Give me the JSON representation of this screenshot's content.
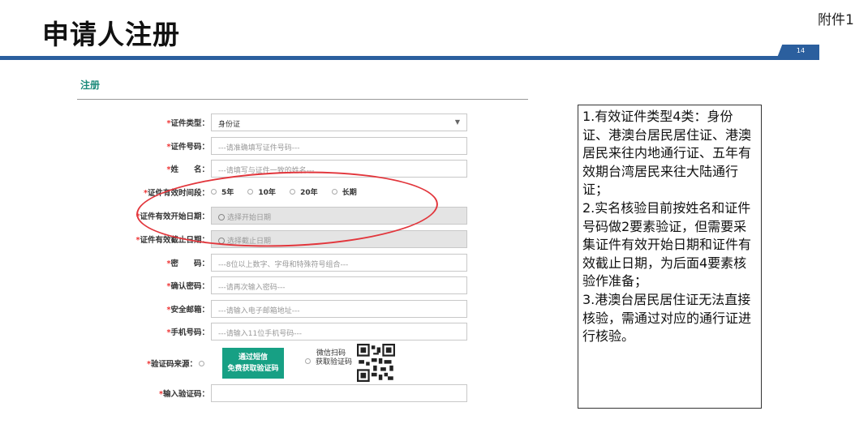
{
  "slide": {
    "title": "申请人注册",
    "appendix": "附件1",
    "page_number": "14"
  },
  "form": {
    "heading": "注册",
    "fields": {
      "id_type": {
        "label": "证件类型：",
        "value": "身份证"
      },
      "id_number": {
        "label": "证件号码：",
        "placeholder": "---请准确填写证件号码---"
      },
      "name": {
        "label": "姓　　名：",
        "placeholder": "---请填写与证件一致的姓名---"
      },
      "validity_period": {
        "label": "证件有效时间段：",
        "options": [
          "5年",
          "10年",
          "20年",
          "长期"
        ]
      },
      "start_date": {
        "label": "证件有效开始日期：",
        "placeholder": "选择开始日期"
      },
      "end_date": {
        "label": "证件有效截止日期：",
        "placeholder": "选择截止日期"
      },
      "password": {
        "label": "密　　码：",
        "placeholder": "---8位以上数字、字母和特殊符号组合---"
      },
      "confirm_password": {
        "label": "确认密码：",
        "placeholder": "---请再次输入密码---"
      },
      "email": {
        "label": "安全邮箱：",
        "placeholder": "---请输入电子邮箱地址---"
      },
      "phone": {
        "label": "手机号码：",
        "placeholder": "---请输入11位手机号码---"
      },
      "code_source": {
        "label": "验证码来源：",
        "sms_button_line1": "通过短信",
        "sms_button_line2": "免费获取验证码",
        "wechat_line1": "微信扫码",
        "wechat_line2": "获取验证码"
      },
      "code_input": {
        "label": "输入验证码："
      }
    }
  },
  "note": {
    "p1": "1.有效证件类型4类：身份证、港澳台居民居住证、港澳居民来往内地通行证、五年有效期台湾居民来往大陆通行证；",
    "p2": "2.实名核验目前按姓名和证件号码做2要素验证，但需要采集证件有效开始日期和证件有效截止日期，为后面4要素核验作准备；",
    "p3": "3.港澳台居民居住证无法直接核验，需通过对应的通行证进行核验。"
  },
  "colors": {
    "accent_blue": "#2b5f9e",
    "heading_green": "#1b8a7a",
    "button_green": "#17a084",
    "annotation_red": "#e2363c",
    "required_red": "#e33333"
  },
  "icons": [
    "clock-icon",
    "chevron-down-icon",
    "qr-code-icon"
  ]
}
